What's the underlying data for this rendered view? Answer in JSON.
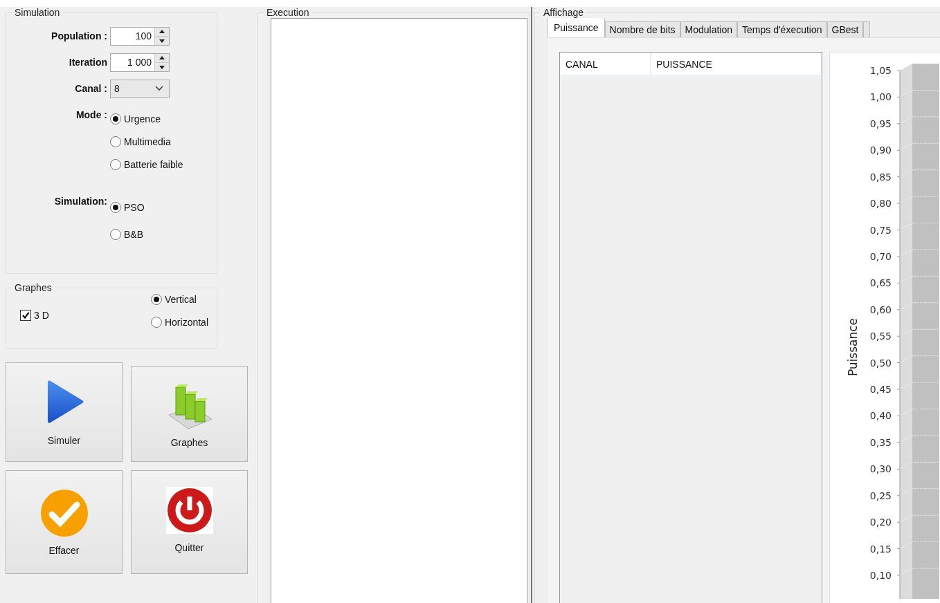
{
  "simulation": {
    "title": "Simulation",
    "fields": [
      {
        "kind": "spin",
        "label": "Population :",
        "value": "100"
      },
      {
        "kind": "spin",
        "label": "Iteration",
        "value": "1 000"
      },
      {
        "kind": "combo",
        "label": "Canal :",
        "value": "8"
      },
      {
        "kind": "radio",
        "label": "Mode :",
        "options": [
          {
            "label": "Urgence",
            "selected": true
          },
          {
            "label": "Multimedia",
            "selected": false
          },
          {
            "label": "Batterie faible",
            "selected": false
          }
        ]
      },
      {
        "kind": "radio",
        "label": "Simulation:",
        "options": [
          {
            "label": "PSO",
            "selected": true
          },
          {
            "label": "B&B",
            "selected": false
          }
        ]
      }
    ]
  },
  "graphes": {
    "title": "Graphes",
    "checkbox": {
      "label": "3 D",
      "checked": true
    },
    "options": [
      {
        "label": "Vertical",
        "selected": true
      },
      {
        "label": "Horizontal",
        "selected": false
      }
    ]
  },
  "buttons": [
    {
      "kind": "play",
      "label": "Simuler"
    },
    {
      "kind": "chart",
      "label": "Graphes"
    },
    {
      "kind": "check",
      "label": "Effacer"
    },
    {
      "kind": "power",
      "label": "Quitter"
    }
  ],
  "execution": {
    "title": "Execution"
  },
  "affichage": {
    "title": "Affichage",
    "tabs": [
      {
        "label": "Puissance",
        "selected": true
      },
      {
        "label": "Nombre de bits",
        "selected": false
      },
      {
        "label": "Modulation",
        "selected": false
      },
      {
        "label": "Temps d'éxecution",
        "selected": false
      },
      {
        "label": "GBest",
        "selected": false
      }
    ],
    "table": {
      "columns": [
        "CANAL",
        "PUISSANCE"
      ]
    },
    "chart": {
      "axis_title": "Puissance",
      "tick_labels": [
        "1,05",
        "1,00",
        "0,95",
        "0,90",
        "0,85",
        "0,80",
        "0,75",
        "0,70",
        "0,65",
        "0,60",
        "0,55",
        "0,50",
        "0,45",
        "0,40",
        "0,35",
        "0,30",
        "0,25",
        "0,20",
        "0,15",
        "0,10"
      ]
    }
  }
}
